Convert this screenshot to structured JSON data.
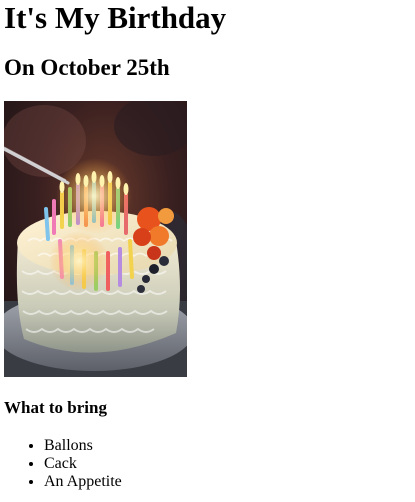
{
  "page": {
    "title": "It's My Birthday",
    "subtitle": "On October 25th"
  },
  "photo": {
    "icon": "birthday-cake-photo",
    "alt": "Birthday cake with lit candles"
  },
  "bring": {
    "heading": "What to bring",
    "items": [
      "Ballons",
      "Cack",
      "An Appetite"
    ]
  }
}
